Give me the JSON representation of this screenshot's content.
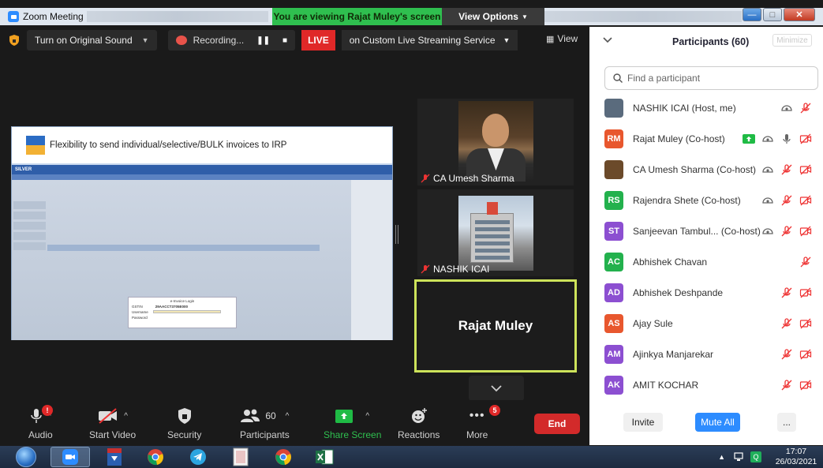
{
  "window": {
    "title": "Zoom Meeting",
    "viewing_banner": "You are viewing Rajat Muley's screen",
    "view_options": "View Options"
  },
  "topbar": {
    "original_sound": "Turn on Original Sound",
    "recording": "Recording...",
    "live": "LIVE",
    "stream_target": "on Custom Live Streaming Service",
    "view": "View"
  },
  "shared_screen": {
    "title": "Flexibility to send individual/selective/BULK invoices to IRP",
    "app_name": "SILVER",
    "dialog_title": "e-Invoice Login",
    "dialog_gstin_label": "GSTIN",
    "dialog_gstin_value": "29AACCT3705E000",
    "dialog_username_label": "Username",
    "dialog_password_label": "Password"
  },
  "videos": [
    {
      "name": "CA Umesh Sharma",
      "muted": true
    },
    {
      "name": "NASHIK ICAI",
      "muted": true
    },
    {
      "name": "Rajat Muley",
      "active_speaker": true
    }
  ],
  "participants_panel": {
    "title": "Participants (60)",
    "minimize": "Minimize",
    "search_placeholder": "Find a participant",
    "participants": [
      {
        "name": "NASHIK ICAI (Host, me)",
        "initials": "",
        "color": "#5a6b7d",
        "icons": [
          "share-screen-icon",
          "mic-muted-icon"
        ]
      },
      {
        "name": "Rajat Muley (Co-host)",
        "initials": "RM",
        "color": "#e8572e",
        "icons": [
          "screen-share-green-icon",
          "share-screen-icon",
          "mic-on-icon",
          "video-off-icon"
        ]
      },
      {
        "name": "CA Umesh Sharma (Co-host)",
        "initials": "",
        "color": "#6b4a2a",
        "icons": [
          "share-screen-icon",
          "mic-muted-icon",
          "video-off-icon"
        ]
      },
      {
        "name": "Rajendra Shete (Co-host)",
        "initials": "RS",
        "color": "#23b14d",
        "icons": [
          "share-screen-icon",
          "mic-muted-icon",
          "video-off-icon"
        ]
      },
      {
        "name": "Sanjeevan Tambul... (Co-host)",
        "initials": "ST",
        "color": "#8c4fd1",
        "icons": [
          "share-screen-icon",
          "mic-muted-icon",
          "video-off-icon"
        ]
      },
      {
        "name": "Abhishek Chavan",
        "initials": "AC",
        "color": "#23b14d",
        "icons": [
          "mic-muted-icon"
        ]
      },
      {
        "name": "Abhishek Deshpande",
        "initials": "AD",
        "color": "#8c4fd1",
        "icons": [
          "mic-muted-icon",
          "video-off-icon"
        ]
      },
      {
        "name": "Ajay Sule",
        "initials": "AS",
        "color": "#e8572e",
        "icons": [
          "mic-muted-icon",
          "video-off-icon"
        ]
      },
      {
        "name": "Ajinkya Manjarekar",
        "initials": "AM",
        "color": "#8c4fd1",
        "icons": [
          "mic-muted-icon",
          "video-off-icon"
        ]
      },
      {
        "name": "AMIT KOCHAR",
        "initials": "AK",
        "color": "#8c4fd1",
        "icons": [
          "mic-muted-icon",
          "video-off-icon"
        ]
      }
    ],
    "invite": "Invite",
    "mute_all": "Mute All",
    "more": "..."
  },
  "toolbar": {
    "audio": "Audio",
    "start_video": "Start Video",
    "security": "Security",
    "participants": "Participants",
    "participants_count": "60",
    "share_screen": "Share Screen",
    "reactions": "Reactions",
    "more": "More",
    "more_badge": "5",
    "audio_badge": "!",
    "end": "End"
  },
  "taskbar": {
    "time": "17:07",
    "date": "26/03/2021"
  },
  "colors": {
    "accent_blue": "#2d8cff",
    "live_red": "#e02828",
    "banner_green": "#2fbf4f",
    "share_green": "#1fbb45",
    "speaker_border": "#cde35a"
  }
}
